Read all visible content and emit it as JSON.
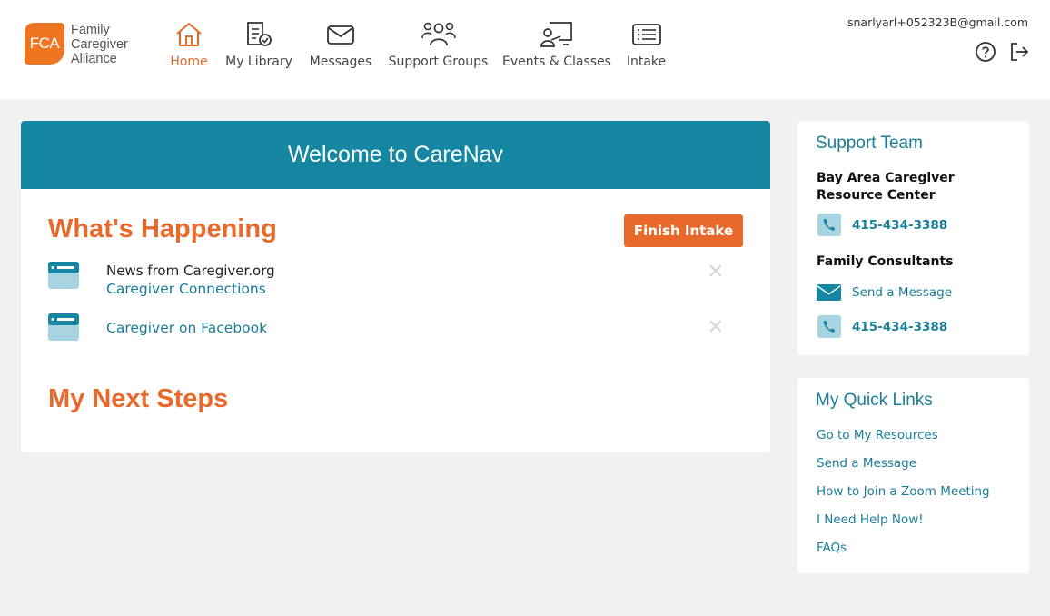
{
  "brand": {
    "logo_mark": "FCA",
    "logo_line1": "Family",
    "logo_line2": "Caregiver",
    "logo_line3": "Alliance",
    "accent_color": "#e8692a",
    "teal_color": "#1687a3"
  },
  "nav": {
    "items": [
      {
        "label": "Home",
        "icon": "home-icon",
        "active": true
      },
      {
        "label": "My Library",
        "icon": "library-icon"
      },
      {
        "label": "Messages",
        "icon": "envelope-icon"
      },
      {
        "label": "Support Groups",
        "icon": "group-icon"
      },
      {
        "label": "Events & Classes",
        "icon": "presentation-icon"
      },
      {
        "label": "Intake",
        "icon": "list-icon"
      }
    ]
  },
  "user": {
    "email": "snarlyarl+052323B@gmail.com",
    "help_icon": "help-circle-icon",
    "logout_icon": "logout-icon"
  },
  "main": {
    "welcome": "Welcome to CareNav",
    "whats_happening": "What's Happening",
    "finish_intake": "Finish Intake",
    "news": [
      {
        "source": "News from Caregiver.org",
        "link": "Caregiver Connections",
        "close": "✕"
      },
      {
        "source": "",
        "link": "Caregiver on Facebook",
        "close": "✕"
      }
    ],
    "next_steps": "My Next Steps"
  },
  "support_team": {
    "title": "Support Team",
    "org_name": "Bay Area Caregiver Resource Center",
    "org_phone": "415-434-3388",
    "consultants_heading": "Family Consultants",
    "send_message": "Send a Message",
    "consultants_phone": "415-434-3388"
  },
  "quick_links": {
    "title": "My Quick Links",
    "items": [
      "Go to My Resources",
      "Send a Message",
      "How to Join a Zoom Meeting",
      "I Need Help Now!",
      "FAQs"
    ]
  }
}
